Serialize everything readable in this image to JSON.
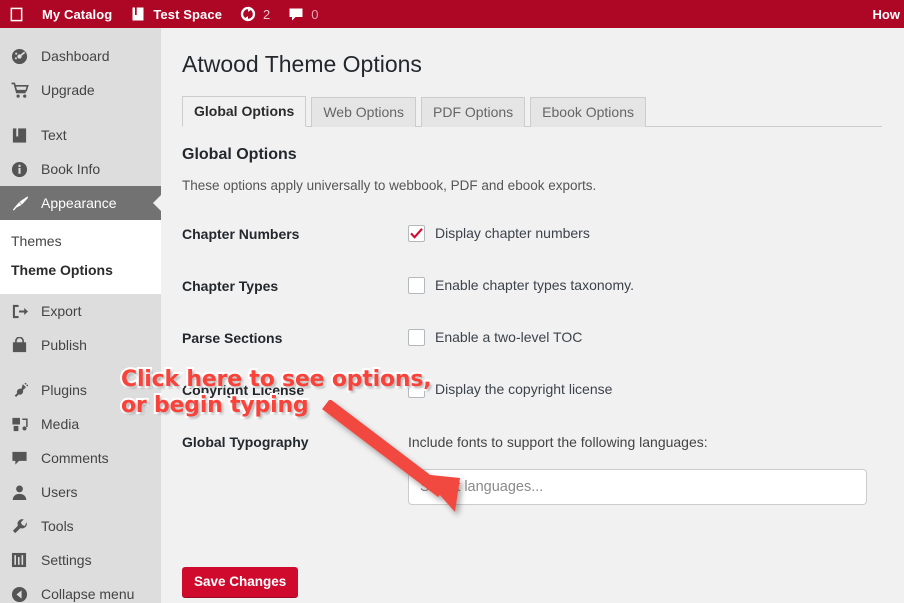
{
  "adminbar": {
    "items": [
      {
        "icon": "wordpress-logo-icon",
        "label": "",
        "count": null
      },
      {
        "icon": "site-icon",
        "label": "My Catalog",
        "count": null
      },
      {
        "icon": "book-icon",
        "label": "Test Space",
        "count": null
      },
      {
        "icon": "update-icon",
        "label": "",
        "count": "2"
      },
      {
        "icon": "comment-bubble-icon",
        "label": "",
        "count": "0"
      }
    ],
    "right_label": "How"
  },
  "sidebar": {
    "items": [
      {
        "label": "Dashboard",
        "icon": "dashboard-icon",
        "current": false
      },
      {
        "label": "Upgrade",
        "icon": "cart-icon",
        "current": false
      },
      {
        "label": "Text",
        "icon": "book-icon",
        "current": false
      },
      {
        "label": "Book Info",
        "icon": "info-icon",
        "current": false
      },
      {
        "label": "Appearance",
        "icon": "brush-icon",
        "current": true
      },
      {
        "label": "Export",
        "icon": "export-icon",
        "current": false
      },
      {
        "label": "Publish",
        "icon": "publish-bag-icon",
        "current": false
      },
      {
        "label": "Plugins",
        "icon": "plugin-icon",
        "current": false
      },
      {
        "label": "Media",
        "icon": "media-icon",
        "current": false
      },
      {
        "label": "Comments",
        "icon": "comment-bubble-icon",
        "current": false
      },
      {
        "label": "Users",
        "icon": "user-icon",
        "current": false
      },
      {
        "label": "Tools",
        "icon": "wrench-icon",
        "current": false
      },
      {
        "label": "Settings",
        "icon": "sliders-icon",
        "current": false
      },
      {
        "label": "Collapse menu",
        "icon": "collapse-arrow-icon",
        "current": false
      }
    ],
    "submenu": [
      {
        "label": "Themes",
        "active": false
      },
      {
        "label": "Theme Options",
        "active": true
      }
    ]
  },
  "page": {
    "title": "Atwood Theme Options",
    "tabs": [
      {
        "label": "Global Options",
        "active": true
      },
      {
        "label": "Web Options",
        "active": false
      },
      {
        "label": "PDF Options",
        "active": false
      },
      {
        "label": "Ebook Options",
        "active": false
      }
    ],
    "section_title": "Global Options",
    "section_desc": "These options apply universally to webbook, PDF and ebook exports.",
    "rows": [
      {
        "label": "Chapter Numbers",
        "checkbox_label": "Display chapter numbers",
        "checked": true
      },
      {
        "label": "Chapter Types",
        "checkbox_label": "Enable chapter types taxonomy.",
        "checked": false
      },
      {
        "label": "Parse Sections",
        "checkbox_label": "Enable a two-level TOC",
        "checked": false
      },
      {
        "label": "Copyright License",
        "checkbox_label": "Display the copyright license",
        "checked": false
      }
    ],
    "typography": {
      "label": "Global Typography",
      "description": "Include fonts to support the following languages:",
      "input_value": "",
      "input_placeholder": "Select languages..."
    },
    "save_label": "Save Changes"
  },
  "annotation": {
    "text": "Click here to see options,\nor begin typing",
    "color": "#f9423a"
  },
  "colors": {
    "brand_red": "#ae0726",
    "button_red": "#cf0a2c",
    "sidebar_bg": "#dddddd",
    "current_item_bg": "#727272",
    "content_bg": "#f1f1f1"
  }
}
